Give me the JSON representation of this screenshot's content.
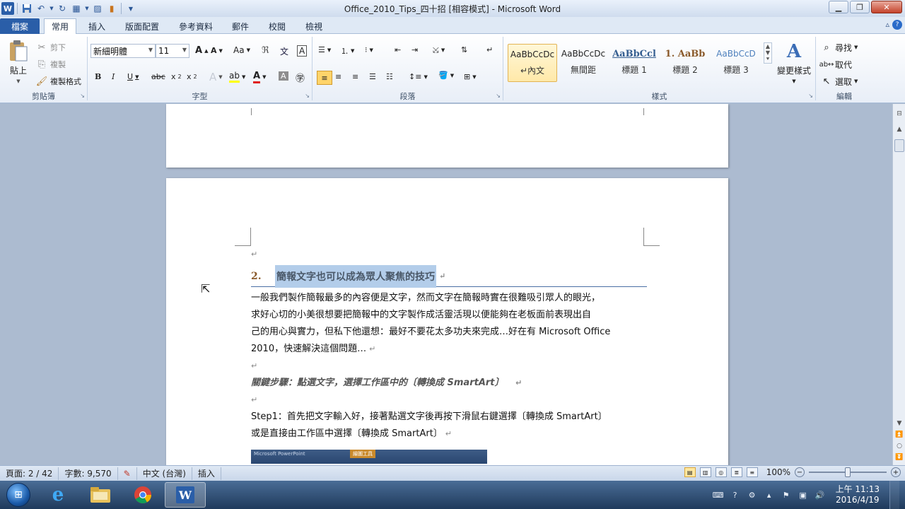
{
  "window": {
    "title": "Office_2010_Tips_四十招 [相容模式] - Microsoft Word",
    "app_icon": "W"
  },
  "qat": {
    "icons": [
      "word-app-icon",
      "save-icon",
      "undo-icon",
      "redo-icon",
      "table-icon",
      "picture-icon",
      "chart-icon",
      "customize-qat-icon"
    ]
  },
  "tabs": [
    {
      "label": "檔案"
    },
    {
      "label": "常用"
    },
    {
      "label": "插入"
    },
    {
      "label": "版面配置"
    },
    {
      "label": "參考資料"
    },
    {
      "label": "郵件"
    },
    {
      "label": "校閱"
    },
    {
      "label": "檢視"
    }
  ],
  "ribbon": {
    "clipboard": {
      "label": "剪貼簿",
      "paste": "貼上",
      "cut": "剪下",
      "copy": "複製",
      "format_painter": "複製格式"
    },
    "font": {
      "label": "字型",
      "font_name": "新細明體",
      "font_size": "11"
    },
    "paragraph": {
      "label": "段落"
    },
    "styles": {
      "label": "樣式",
      "items": [
        {
          "preview": "AaBbCcDc",
          "name": "↵內文"
        },
        {
          "preview": "AaBbCcDc",
          "name": "無間距"
        },
        {
          "preview": "AaBbCcl",
          "name": "標題 1"
        },
        {
          "preview": "1. AaBb",
          "name": "標題 2"
        },
        {
          "preview": "AaBbCcD",
          "name": "標題 3"
        }
      ],
      "change_styles": "變更樣式"
    },
    "editing": {
      "label": "編輯",
      "find": "尋找",
      "replace": "取代",
      "select": "選取"
    }
  },
  "document": {
    "heading_number": "2.",
    "heading_text": "簡報文字也可以成為眾人聚焦的技巧",
    "body_lines": [
      "一般我們製作簡報最多的內容便是文字，然而文字在簡報時實在很難吸引眾人的眼光，",
      "求好心切的小美很想要把簡報中的文字製作成活靈活現以便能夠在老板面前表現出自",
      "己的用心與實力，但私下他還想：最好不要花太多功夫來完成…好在有 Microsoft Office",
      "2010，快速解決這個問題…"
    ],
    "key_step": "關鍵步驟：點選文字，選擇工作區中的〔轉換成 SmartArt〕",
    "step1_lines": [
      "Step1：首先把文字輸入好，接著點選文字後再按下滑鼠右鍵選擇〔轉換成 SmartArt〕",
      "或是直接由工作區中選擇〔轉換成 SmartArt〕"
    ],
    "paragraph_mark": "↵",
    "screenshot_caption": "Microsoft PowerPoint",
    "screenshot_tab": "繪圖工具"
  },
  "statusbar": {
    "page": "頁面: 2 / 42",
    "words": "字數: 9,570",
    "language": "中文 (台灣)",
    "mode": "插入",
    "zoom": "100%",
    "zoom_fraction": 0.5
  },
  "taskbar": {
    "apps": [
      "explorer-icon",
      "internet-explorer-icon",
      "file-explorer-icon",
      "chrome-icon",
      "word-icon"
    ],
    "time": "上午 11:13",
    "date": "2016/4/19"
  },
  "colors": {
    "file_tab": "#2a5ea8",
    "heading_underline": "#4a6fa5",
    "selection": "#b3cdea",
    "taskbar": "#1f3a5c"
  }
}
